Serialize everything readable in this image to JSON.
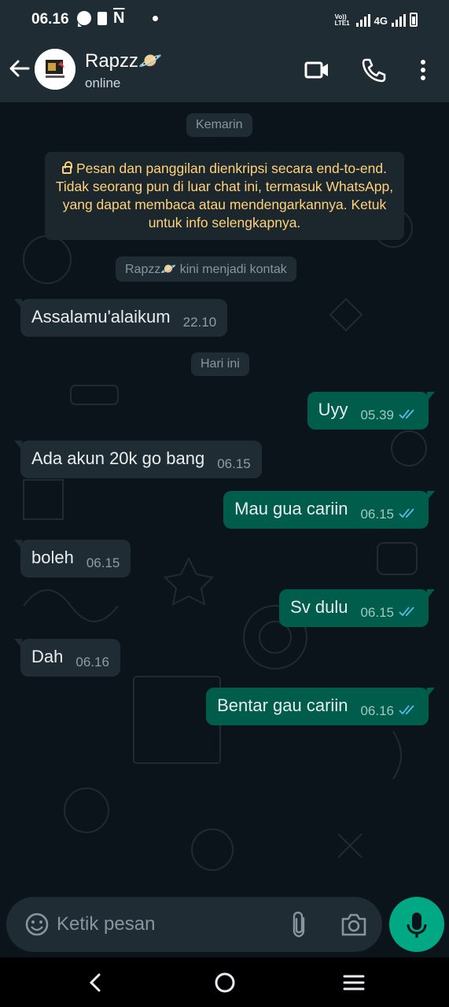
{
  "status_bar": {
    "time": "06.16",
    "volte_line1": "Vo))",
    "volte_line2": "LTE1",
    "network": "4G"
  },
  "header": {
    "contact_name": "Rapzz🪐",
    "contact_status": "online"
  },
  "chat": {
    "date_yesterday": "Kemarin",
    "encryption_notice": "Pesan dan panggilan dienkripsi secara end-to-end. Tidak seorang pun di luar chat ini, termasuk WhatsApp, yang dapat membaca atau mendengarkannya. Ketuk untuk info selengkapnya.",
    "contact_added": "Rapzz🪐 kini menjadi kontak",
    "date_today": "Hari ini",
    "messages": [
      {
        "direction": "in",
        "text": "Assalamu'alaikum",
        "time": "22.10"
      },
      {
        "direction": "out",
        "text": "Uyy",
        "time": "05.39",
        "status": "read"
      },
      {
        "direction": "in",
        "text": "Ada akun 20k go bang",
        "time": "06.15"
      },
      {
        "direction": "out",
        "text": "Mau gua cariin",
        "time": "06.15",
        "status": "read"
      },
      {
        "direction": "in",
        "text": "boleh",
        "time": "06.15"
      },
      {
        "direction": "out",
        "text": "Sv dulu",
        "time": "06.15",
        "status": "read"
      },
      {
        "direction": "in",
        "text": "Dah",
        "time": "06.16"
      },
      {
        "direction": "out",
        "text": "Bentar gau cariin",
        "time": "06.16",
        "status": "read"
      }
    ]
  },
  "input": {
    "placeholder": "Ketik pesan"
  },
  "colors": {
    "background": "#0b141a",
    "header": "#1f2c34",
    "incoming_bubble": "#1f2c34",
    "outgoing_bubble": "#005c4b",
    "accent": "#00a884",
    "read_ticks": "#53bdeb",
    "encryption_text": "#ffd279"
  },
  "icons": {
    "back": "arrow-left-icon",
    "video": "video-camera-icon",
    "call": "phone-icon",
    "menu": "more-vertical-icon",
    "emoji": "emoji-icon",
    "attach": "paperclip-icon",
    "camera": "camera-icon",
    "mic": "microphone-icon"
  }
}
